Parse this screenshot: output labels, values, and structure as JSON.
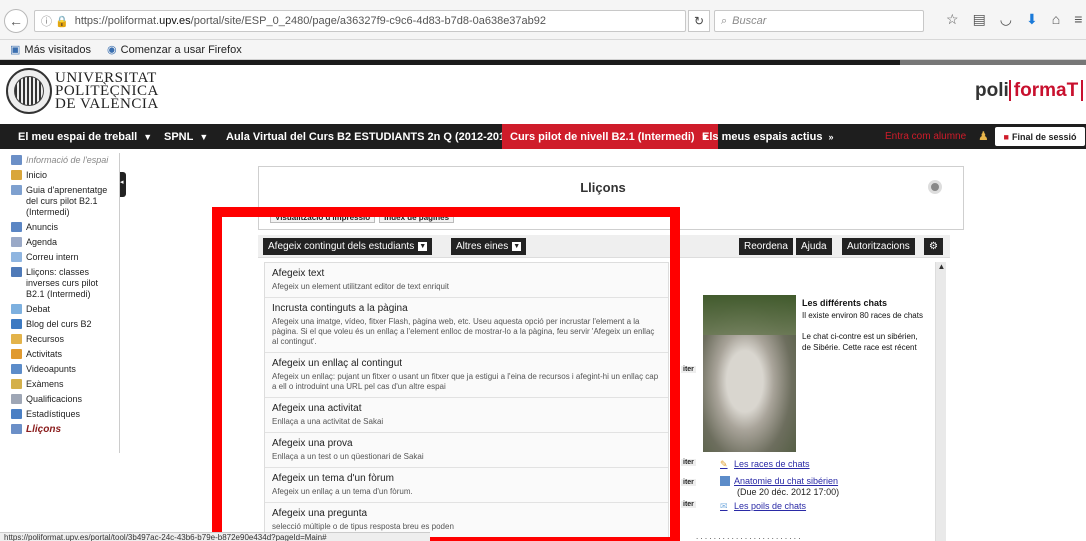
{
  "browser": {
    "url_prefix": "https://poliformat.",
    "url_domain": "upv.es",
    "url_rest": "/portal/site/ESP_0_2480/page/a36327f9-c9c6-4d83-b7d8-0a638e37ab92",
    "search_placeholder": "Buscar",
    "bookmarks": [
      "Más visitados",
      "Comenzar a usar Firefox"
    ]
  },
  "header": {
    "uni_line1": "UNIVERSITAT",
    "uni_line2": "POLITÈCNICA",
    "uni_line3": "DE VALÈNCIA",
    "logo_left": "poli",
    "logo_right": "formaT"
  },
  "nav": {
    "items": [
      "El meu espai de treball",
      "SPNL",
      "Aula Virtual del Curs B2 ESTUDIANTS 2n Q (2012-2013)",
      "Curs pilot de nivell B2.1 (Intermedi)",
      "Els meus espais actius"
    ],
    "entra_label": "Entra com alumne",
    "logout_label": "Final de sessió"
  },
  "sidebar": {
    "items": [
      {
        "label": "Informació de l'espai",
        "color": "#6b8fc7",
        "style": "info"
      },
      {
        "label": "Inicio",
        "color": "#d9a63a",
        "style": ""
      },
      {
        "label": "Guia d'aprenentatge del curs pilot B2.1 (Intermedi)",
        "color": "#7ea0cf",
        "style": ""
      },
      {
        "label": "Anuncis",
        "color": "#5b86c4",
        "style": ""
      },
      {
        "label": "Agenda",
        "color": "#9aa9c7",
        "style": ""
      },
      {
        "label": "Correu intern",
        "color": "#8fb5e0",
        "style": ""
      },
      {
        "label": "Lliçons: classes inverses curs pilot B2.1 (Intermedi)",
        "color": "#4f7ab8",
        "style": ""
      },
      {
        "label": "Debat",
        "color": "#7db0df",
        "style": ""
      },
      {
        "label": "Blog del curs B2",
        "color": "#3c79c2",
        "style": ""
      },
      {
        "label": "Recursos",
        "color": "#e3b34a",
        "style": ""
      },
      {
        "label": "Activitats",
        "color": "#e09a2f",
        "style": ""
      },
      {
        "label": "Videoapunts",
        "color": "#5c8cc9",
        "style": ""
      },
      {
        "label": "Exàmens",
        "color": "#d4b04a",
        "style": ""
      },
      {
        "label": "Qualificacions",
        "color": "#9ea6b5",
        "style": ""
      },
      {
        "label": "Estadístiques",
        "color": "#4a7fc4",
        "style": ""
      },
      {
        "label": "Lliçons",
        "color": "#6b8fc7",
        "style": "cur"
      }
    ]
  },
  "main": {
    "title": "Lliçons",
    "small_buttons": [
      "Visualització d'impressió",
      "Índex de pàgines"
    ],
    "add_student_content": "Afegeix contingut dels estudiants",
    "other_tools": "Altres eines",
    "reorder": "Reordena",
    "help": "Ajuda",
    "permissions": "Autoritzacions"
  },
  "dropdown": {
    "items": [
      {
        "title": "Afegeix text",
        "desc": "Afegeix un element utilitzant editor de text enriquit"
      },
      {
        "title": "Incrusta continguts a la pàgina",
        "desc": "Afegeix una imatge, vídeo, fitxer Flash, pàgina web, etc. Useu aquesta opció per incrustar l'element a la pàgina. Si el que voleu és un enllaç a l'element enlloc de mostrar-lo a la pàgina, feu servir 'Afegeix un enllaç al contingut'."
      },
      {
        "title": "Afegeix un enllaç al contingut",
        "desc": "Afegeix un enllaç: pujant un fitxer o usant un fitxer que ja estigui a l'eina de recursos i afegint-hi un enllaç cap a ell o introduint una URL pel cas d'un altre espai"
      },
      {
        "title": "Afegeix una activitat",
        "desc": "Enllaça a una activitat de Sakai"
      },
      {
        "title": "Afegeix una prova",
        "desc": "Enllaça a un test o un qüestionari de Sakai"
      },
      {
        "title": "Afegeix un tema d'un fòrum",
        "desc": "Afegeix un enllaç a un tema d'un fòrum."
      },
      {
        "title": "Afegeix una pregunta",
        "desc": "selecció múltiple o de tipus resposta breu es poden"
      }
    ]
  },
  "right": {
    "heading": "Les différents chats",
    "line1": "Il existe environ 80 races de chats",
    "line2": "Le chat ci-contre est un sibérien,",
    "line3": "de Sibérie.  Cette race est récent",
    "link1": "Les races de chats",
    "link2": "Anatomie du chat sibérien",
    "link2_date": "(Due 20 déc. 2012 17:00)",
    "link3": "Les poils de chats",
    "edit_tab": "iter"
  },
  "status": {
    "url": "https://poliformat.upv.es/portal/tool/3b497ac-24c-43b6-b79e-b872e90e434d?pageId=Main#"
  }
}
